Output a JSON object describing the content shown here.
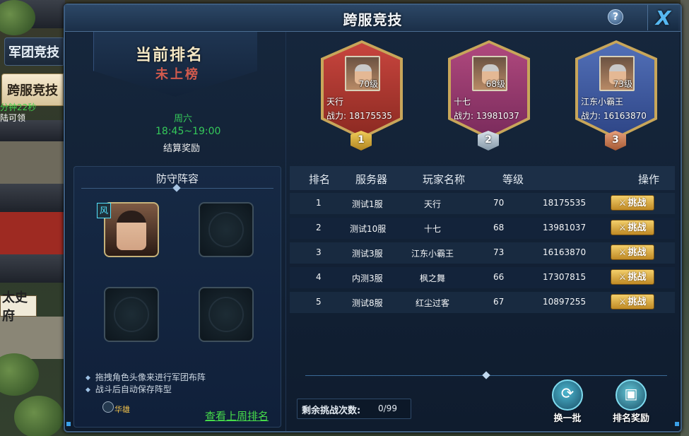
{
  "side": {
    "tab_legion": "军团竞技",
    "tab_cross": "跨服竞技",
    "note_1": "分钟22秒",
    "note_2": "陆可领",
    "building": "太史府"
  },
  "window": {
    "title": "跨服竞技",
    "help": "?",
    "close": "X"
  },
  "status": {
    "rank_label": "当前排名",
    "rank_value": "未上榜",
    "day": "周六",
    "time": "18:45~19:00",
    "reward_label": "结算奖励"
  },
  "defense": {
    "title": "防守阵容",
    "hero_badge": "风",
    "hero_name": "华雄",
    "tips": [
      "拖拽角色头像来进行军团布阵",
      "战斗后自动保存阵型"
    ],
    "last_week_link": "查看上周排名"
  },
  "top_three": [
    {
      "rank": "1",
      "level": "70级",
      "name": "天行",
      "power": "战力:  18175535",
      "color": "#c8453e"
    },
    {
      "rank": "2",
      "level": "68级",
      "name": "十七",
      "power": "战力:  13981037",
      "color": "#b0497e"
    },
    {
      "rank": "3",
      "level": "73级",
      "name": "江东小霸王",
      "power": "战力:  16163870",
      "color": "#5270b8"
    }
  ],
  "table": {
    "headers": {
      "rank": "排名",
      "server": "服务器",
      "player": "玩家名称",
      "level": "等级",
      "action": "操作"
    },
    "challenge_label": "挑战",
    "rows": [
      {
        "rank": "1",
        "server": "测试1服",
        "player": "天行",
        "level": "70",
        "power": "18175535"
      },
      {
        "rank": "2",
        "server": "测试10服",
        "player": "十七",
        "level": "68",
        "power": "13981037"
      },
      {
        "rank": "3",
        "server": "测试3服",
        "player": "江东小霸王",
        "level": "73",
        "power": "16163870"
      },
      {
        "rank": "4",
        "server": "内测3服",
        "player": "枫之舞",
        "level": "66",
        "power": "17307815"
      },
      {
        "rank": "5",
        "server": "测试8服",
        "player": "红尘过客",
        "level": "67",
        "power": "10897255"
      }
    ]
  },
  "footer": {
    "remain_label": "剩余挑战次数:",
    "remain_value": "0/99",
    "refresh_label": "换一批",
    "refresh_icon": "refresh-icon",
    "reward_label": "排名奖励",
    "reward_icon": "treasure-chest-icon"
  },
  "colors": {
    "accent_green": "#46dc4a",
    "gold_button": "#f3cf6b",
    "panel": "#16273d"
  }
}
